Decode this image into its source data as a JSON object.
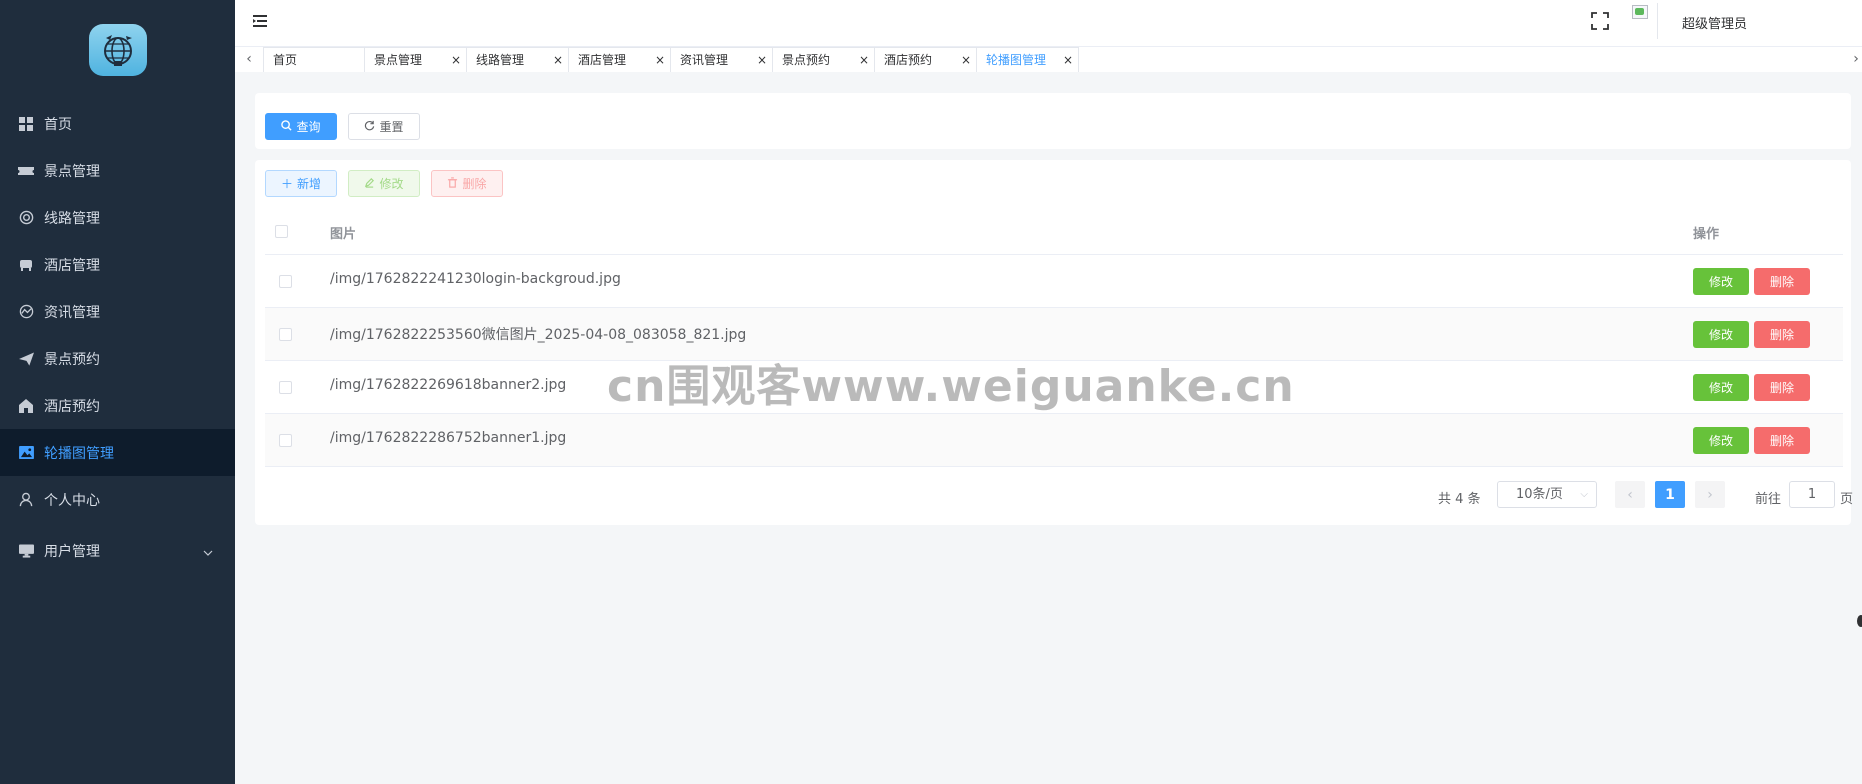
{
  "sidebar": {
    "logo_icon": "globe-logo-icon",
    "items": [
      {
        "label": "首页",
        "icon": "grid-icon"
      },
      {
        "label": "景点管理",
        "icon": "ticket-icon"
      },
      {
        "label": "线路管理",
        "icon": "ring-icon"
      },
      {
        "label": "酒店管理",
        "icon": "bed-icon"
      },
      {
        "label": "资讯管理",
        "icon": "chart-circle-icon"
      },
      {
        "label": "景点预约",
        "icon": "send-icon"
      },
      {
        "label": "酒店预约",
        "icon": "home-icon"
      },
      {
        "label": "轮播图管理",
        "icon": "picture-icon",
        "active": true
      },
      {
        "label": "个人中心",
        "icon": "user-icon"
      },
      {
        "label": "用户管理",
        "icon": "monitor-icon"
      }
    ]
  },
  "header": {
    "user_name": "超级管理员"
  },
  "tabs": [
    {
      "label": "首页",
      "closable": false
    },
    {
      "label": "景点管理",
      "closable": true
    },
    {
      "label": "线路管理",
      "closable": true
    },
    {
      "label": "酒店管理",
      "closable": true
    },
    {
      "label": "资讯管理",
      "closable": true
    },
    {
      "label": "景点预约",
      "closable": true
    },
    {
      "label": "酒店预约",
      "closable": true
    },
    {
      "label": "轮播图管理",
      "closable": true,
      "active": true
    }
  ],
  "query": {
    "search_label": "查询",
    "reset_label": "重置"
  },
  "toolbar": {
    "add_label": "新增",
    "edit_label": "修改",
    "delete_label": "删除"
  },
  "table": {
    "columns": [
      "图片",
      "操作"
    ],
    "rows": [
      {
        "path": "/img/1762822241230login-backgroud.jpg"
      },
      {
        "path": "/img/1762822253560微信图片_2025-04-08_083058_821.jpg"
      },
      {
        "path": "/img/1762822269618banner2.jpg"
      },
      {
        "path": "/img/1762822286752banner1.jpg"
      }
    ],
    "row_edit_label": "修改",
    "row_delete_label": "删除"
  },
  "pagination": {
    "total_text": "共 4 条",
    "page_size_text": "10条/页",
    "current_page": "1",
    "goto_label": "前往",
    "goto_value": "1",
    "page_label": "页"
  },
  "watermark": "cn围观客www.weiguanke.cn",
  "colors": {
    "sidebar_bg": "#1f2d3d",
    "primary": "#409eff",
    "success": "#67c23a",
    "danger": "#f56c6c"
  }
}
